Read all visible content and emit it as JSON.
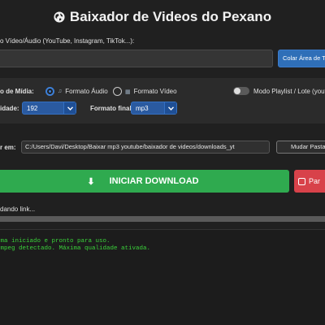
{
  "header": {
    "title": "Baixador de Videos do Pexano",
    "icon": "globe-icon"
  },
  "url_section": {
    "label": "o Vídeo/Áudio (YouTube, Instagram, TikTok...):",
    "input_value": "",
    "paste_button": "Colar Área de Tra"
  },
  "media": {
    "label": "o de Mídia:",
    "options": [
      {
        "label": "Formato Áudio",
        "selected": true,
        "icon": "music-icon"
      },
      {
        "label": "Formato Vídeo",
        "selected": false,
        "icon": "film-icon"
      }
    ],
    "playlist_label": "Modo Playlist / Lote (youtub",
    "playlist_enabled": false
  },
  "quality": {
    "label": "idade:",
    "value": "192"
  },
  "format": {
    "label": "Formato final:",
    "value": "mp3"
  },
  "save": {
    "label": "r em:",
    "path": "C:/Users/Davi/Desktop/Baixar mp3 youtube/baixador de videos/downloads_yt",
    "change_button": "Mudar Pasta"
  },
  "actions": {
    "download_label": "INICIAR DOWNLOAD",
    "download_icon": "⬇",
    "pause_label": "Par"
  },
  "status": {
    "text": "dando link...",
    "progress": 1.0
  },
  "log": {
    "lines": [
      "ema iniciado e pronto para uso.",
      "fmpeg detectado. Máxima qualidade ativada."
    ],
    "color": "#3ad23a"
  },
  "colors": {
    "accent": "#2f6fb8",
    "success": "#2faa4f",
    "danger": "#d8424a"
  }
}
